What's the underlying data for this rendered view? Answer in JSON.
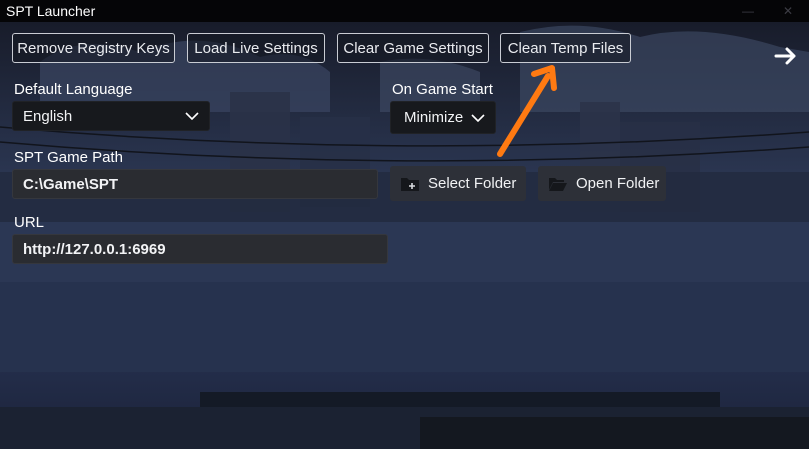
{
  "window": {
    "title": "SPT Launcher",
    "minimize_icon": "minimize-icon",
    "close_icon": "close-icon"
  },
  "toolbar": {
    "remove_registry_keys": "Remove Registry Keys",
    "load_live_settings": "Load Live Settings",
    "clear_game_settings": "Clear Game Settings",
    "clean_temp_files": "Clean Temp Files",
    "next_icon": "arrow-right-icon"
  },
  "settings": {
    "default_language": {
      "label": "Default Language",
      "value": "English"
    },
    "on_game_start": {
      "label": "On Game Start",
      "value": "Minimize"
    },
    "game_path": {
      "label": "SPT Game Path",
      "value": "C:\\Game\\SPT"
    },
    "select_folder": "Select Folder",
    "open_folder": "Open Folder",
    "url": {
      "label": "URL",
      "value": "http://127.0.0.1:6969"
    }
  },
  "annotation": {
    "color": "#ff7a12",
    "icon": "orange-pointer-arrow"
  },
  "colors": {
    "accent_border": "#c9ccd3",
    "field_bg": "#2a2c31",
    "button_bg": "#2d3038"
  }
}
